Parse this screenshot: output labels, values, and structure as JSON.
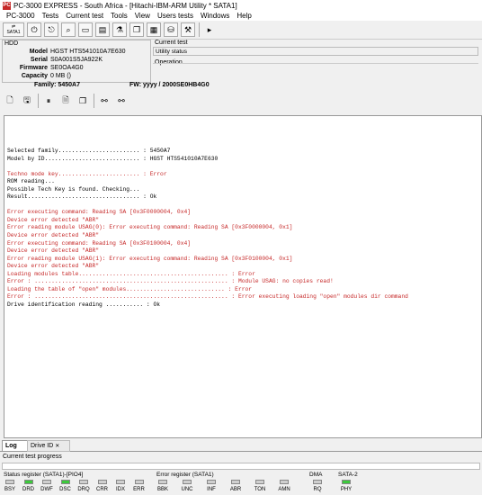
{
  "window": {
    "title": "PC-3000 EXPRESS - South Africa - [Hitachi-IBM-ARM Utility * SATA1]",
    "app_icon_text": "PC"
  },
  "menu": [
    "PC-3000",
    "Tests",
    "Current test",
    "Tools",
    "View",
    "Users tests",
    "Windows",
    "Help"
  ],
  "toolbar": {
    "sata_label": "SATA1"
  },
  "hdd": {
    "legend": "HDD",
    "model_label": "Model",
    "model": "HGST HTS541010A7E630",
    "serial_label": "Serial",
    "serial": "S0A001S5JA922K",
    "firmware_label": "Firmware",
    "firmware": "SE0OA4G0",
    "capacity_label": "Capacity",
    "capacity": "0 MB ()"
  },
  "family_line": {
    "family": "Family: 5450A7",
    "fw": "FW: yyyy / 2000SE0HB4G0"
  },
  "current_test": {
    "legend": "Current test",
    "status": "Utility status",
    "operation_legend": "Operation"
  },
  "log": [
    {
      "t": "Selected family........................ : 5450A7",
      "err": false
    },
    {
      "t": "Model by ID............................ : HGST HTS541010A7E630",
      "err": false
    },
    {
      "t": "",
      "err": false
    },
    {
      "t": "Techno mode key........................ : Error",
      "err": true
    },
    {
      "t": "ROM reading...",
      "err": false
    },
    {
      "t": "Possible Tech Key is found. Checking...",
      "err": false
    },
    {
      "t": "Result................................. : Ok",
      "err": false
    },
    {
      "t": "",
      "err": false
    },
    {
      "t": "Error executing command: Reading SA [0x3F0000004, 0x4]",
      "err": true
    },
    {
      "t": "Device error detected \"ABR\"",
      "err": true
    },
    {
      "t": "Error reading module USAG(0): Error executing command: Reading SA [0x3F0000004, 0x1]",
      "err": true
    },
    {
      "t": "Device error detected \"ABR\"",
      "err": true
    },
    {
      "t": "Error executing command: Reading SA [0x3F0100004, 0x4]",
      "err": true
    },
    {
      "t": "Device error detected \"ABR\"",
      "err": true
    },
    {
      "t": "Error reading module USAG(1): Error executing command: Reading SA [0x3F0100004, 0x1]",
      "err": true
    },
    {
      "t": "Device error detected \"ABR\"",
      "err": true
    },
    {
      "t": "Loading modules table............................................ : Error",
      "err": true
    },
    {
      "t": "Error : ......................................................... : Module USAG: no copies read!",
      "err": true
    },
    {
      "t": "Loading the table of \"open\" modules............................. : Error",
      "err": true
    },
    {
      "t": "Error : ......................................................... : Error executing loading \"open\" modules dir command",
      "err": true
    },
    {
      "t": "Drive identification reading ........... : Ok",
      "err": false
    }
  ],
  "tabs": {
    "log": "Log",
    "drive_id": "Drive ID",
    "close": "✕"
  },
  "progress": {
    "label": "Current test progress",
    "fraction": 0
  },
  "registers": {
    "status": {
      "title": "Status register (SATA1)-[PIO4]",
      "leds": [
        {
          "name": "BSY",
          "on": false
        },
        {
          "name": "DRD",
          "on": true
        },
        {
          "name": "DWF",
          "on": false
        },
        {
          "name": "DSC",
          "on": true
        },
        {
          "name": "DRQ",
          "on": false
        },
        {
          "name": "CRR",
          "on": false
        },
        {
          "name": "IDX",
          "on": false
        },
        {
          "name": "ERR",
          "on": false
        }
      ]
    },
    "error": {
      "title": "Error register (SATA1)",
      "leds": [
        {
          "name": "BBK",
          "on": false
        },
        {
          "name": "UNC",
          "on": false
        },
        {
          "name": "INF",
          "on": false
        },
        {
          "name": "ABR",
          "on": false
        },
        {
          "name": "TON",
          "on": false
        },
        {
          "name": "AMN",
          "on": false
        }
      ]
    },
    "dma": {
      "title": "DMA",
      "leds": [
        {
          "name": "RQ",
          "on": false
        }
      ]
    },
    "sata": {
      "title": "SATA-2",
      "leds": [
        {
          "name": "PHY",
          "on": true
        }
      ]
    }
  }
}
